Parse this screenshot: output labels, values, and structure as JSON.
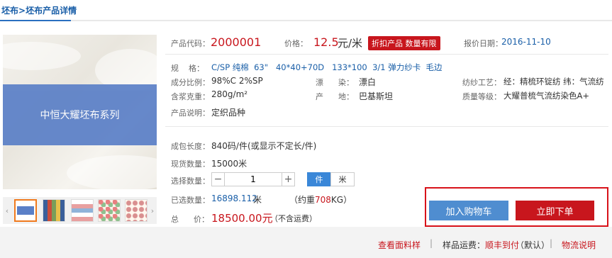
{
  "breadcrumb": {
    "root": "坯布",
    "sep": ">",
    "current": "坯布产品详情"
  },
  "product_image": {
    "banner_text": "中恒大耀坯布系列"
  },
  "thumbnails": {
    "prev": "‹",
    "next": "›",
    "count": 5
  },
  "header": {
    "code_label": "产品代码：",
    "code_value": "2000001",
    "price_label": "价格：",
    "price_value": "12.5",
    "price_unit": "元/米",
    "promo_tag": "折扣产品 数量有限",
    "date_label": "报价日期：",
    "date_value": "2016-11-10"
  },
  "specs": {
    "spec_label": "规    格：",
    "spec_value": "C/SP 纯棉  63\"   40*40+70D   133*100  3/1 弹力纱卡  毛边",
    "composition_label": "成分比例：",
    "composition_value": "98%C  2%SP",
    "bleach_label": "漂      染：",
    "bleach_value": "漂白",
    "spinning_label": "纺纱工艺：",
    "spinning_value": "经：精梳环锭纺 纬：气流纺",
    "weight_label": "含浆克重：",
    "weight_value": "280g/m²",
    "origin_label": "产      地：",
    "origin_value": "巴基斯坦",
    "quality_label": "质量等级：",
    "quality_value": "大耀普梳气流纺染色A+",
    "desc_label": "产品说明：",
    "desc_value": "定织品种"
  },
  "order": {
    "pack_label": "成包长度：",
    "pack_value": "840码/件(或显示不定长/件)",
    "stock_label": "现货数量：",
    "stock_value": "15000米",
    "select_label": "选择数量：",
    "qty_minus": "−",
    "qty_value": "1",
    "qty_plus": "+",
    "unit_piece": "件",
    "unit_meter": "米",
    "selected_label": "已选数量：",
    "selected_value": "16898.112",
    "selected_unit": "米",
    "approx_prefix": "（约重",
    "approx_weight": "708",
    "approx_suffix": "KG）",
    "total_label": "总      价：",
    "total_value": "18500.00元",
    "total_note": "（不含运费）"
  },
  "actions": {
    "add_cart": "加入购物车",
    "buy_now": "立即下单"
  },
  "footer": {
    "sample_link": "查看面料样",
    "shipping_label": "样品运费：",
    "shipping_value": "顺丰到付",
    "shipping_default": "（默认）",
    "logistics_link": "物流说明"
  },
  "colors": {
    "accent_blue": "#1a5fa8",
    "accent_red": "#c8161d",
    "button_blue": "#4f8dd0"
  }
}
